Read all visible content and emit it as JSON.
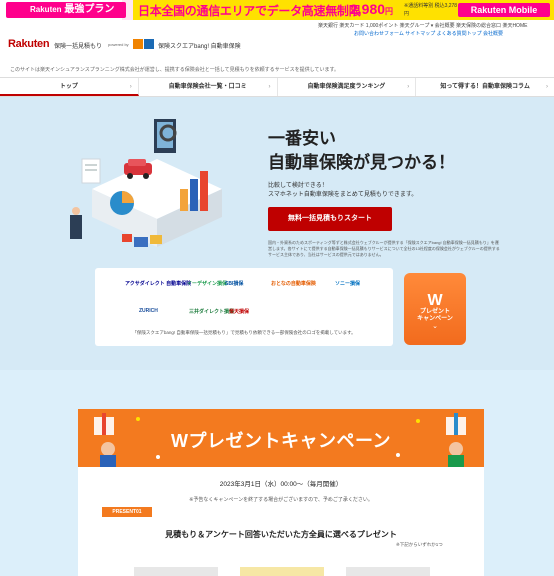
{
  "promo": {
    "brand": "Rakuten",
    "plan": "最強プラン",
    "tag": "R",
    "headline": "日本全国の通信エリアでデータ高速無制限",
    "price": "2,980",
    "price_suffix": "円",
    "price_note": "※通話料等別 税込3,278円",
    "right_brand": "Rakuten Mobile"
  },
  "util": {
    "line1": "楽天銀行 楽天カード 1,000ポイント  楽天グループ ▾   会社概要   楽天保険の総合窓口   楽天HOME",
    "line2": "お問い合わせフォーム   サイトマップ   よくある質問トップ   会社概要"
  },
  "header": {
    "logo": "Rakuten",
    "logo_sub": "保険一括見積もり",
    "powered_by": "powered by",
    "partner_logo": "保険スクエアbang!",
    "partner_name": "保険スクエアbang! 自動車保険"
  },
  "notice": "このサイトは楽天インシュアランスプランニング株式会社が運営し、提携する保険会社と一括して見積もりを依頼するサービスを提供しています。",
  "nav": [
    {
      "label": "トップ",
      "active": true
    },
    {
      "label": "自動車保険会社一覧・口コミ",
      "active": false
    },
    {
      "label": "自動車保険満足度ランキング",
      "active": false
    },
    {
      "label": "知って得する！自動車保険コラム",
      "active": false
    }
  ],
  "hero": {
    "title_line1": "一番安い",
    "title_line2": "自動車保険が見つかる！",
    "sub_line1": "比較して検討できる！",
    "sub_line2": "スマホネット自動車保険をまとめて見積もりできます。",
    "cta": "無料一括見積もりスタート",
    "note": "国内・外資系のためスポーティング等ずと株式会社ウェブクルーが提供する「保険スクエアbang! 自動車保険一括見積もり」を運営します。各サイトにて提供する自動車保険一括見積もりサービスについて全社の13社程度の保険会社がウェブクルーの提供するサービス主体であり、当社はサービスの提供元ではありません。"
  },
  "insurers": {
    "items": [
      {
        "name": "アクサダイレクト 自動車保険",
        "color": "#00008f"
      },
      {
        "name": "イーデザイン損保",
        "color": "#1a9a4b"
      },
      {
        "name": "SBI損保",
        "color": "#0050a0"
      },
      {
        "name": "おとなの自動車保険",
        "color": "#e45c00"
      },
      {
        "name": "ソニー損保",
        "color": "#0070c0"
      },
      {
        "name": "ZURICH",
        "color": "#1b4f9c"
      },
      {
        "name": "三井ダイレクト損保",
        "color": "#1a7a3a"
      },
      {
        "name": "楽天損保",
        "color": "#bf0000"
      }
    ],
    "footnote": "「保険スクエアbang! 自動車保険一括見積もり」で見積もり依頼できる一部保険会社のロゴを掲載しています。"
  },
  "badge": {
    "big": "W",
    "line1": "プレゼント",
    "line2": "キャンペーン"
  },
  "campaign": {
    "title": "Wプレゼントキャンペーン",
    "date": "2023年3月1日（水）00:00〜（毎月開催）",
    "date_note": "※予告なくキャンペーンを終了する場合がございますので、予めご了承ください。",
    "present_tag": "PRESENT01",
    "lead": "見積もり＆アンケート回答いただいた方全員に選べるプレゼント",
    "lead_note": "※下記からいずれか1つ"
  },
  "colors": {
    "brand_red": "#bf0000",
    "promo_pink": "#ff008c",
    "hero_bg": "#d6eaf6",
    "campaign_orange": "#f37a1f"
  }
}
